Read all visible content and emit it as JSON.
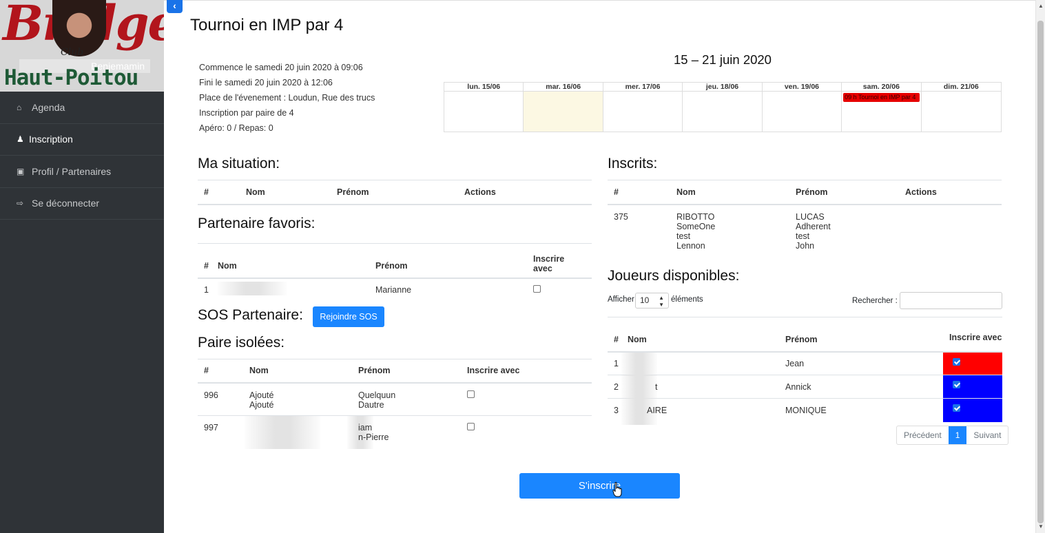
{
  "sidebar": {
    "logo_script": "Bridge",
    "logo_club": "Club",
    "username": "Benjemamin",
    "logo_region": "Haut-Poitou",
    "items": [
      {
        "label": "Agenda",
        "icon": "home-icon"
      },
      {
        "label": "Inscription",
        "icon": "users-icon"
      },
      {
        "label": "Profil / Partenaires",
        "icon": "gift-icon"
      },
      {
        "label": "Se déconnecter",
        "icon": "logout-icon"
      }
    ]
  },
  "page": {
    "title": "Tournoi en IMP par 4"
  },
  "event_info": {
    "start": "Commence le samedi 20 juin 2020 à 09:06",
    "end": "Fini le samedi 20 juin 2020 à 12:06",
    "place": "Place de l'évenement : Loudun, Rue des trucs",
    "pairs": "Inscription par paire de 4",
    "apero": "Apéro: 0 / Repas: 0"
  },
  "calendar": {
    "title": "15 – 21 juin 2020",
    "days": [
      "lun. 15/06",
      "mar. 16/06",
      "mer. 17/06",
      "jeu. 18/06",
      "ven. 19/06",
      "sam. 20/06",
      "dim. 21/06"
    ],
    "event_label": "09 h Tournoi en IMP par 4",
    "event_color": "#e60000",
    "today_color": "#fcf8e3"
  },
  "ma_situation": {
    "title": "Ma situation:",
    "columns": [
      "#",
      "Nom",
      "Prénom",
      "Actions"
    ]
  },
  "partenaire_favoris": {
    "title": "Partenaire favoris:",
    "columns": [
      "#",
      "Nom",
      "Prénom",
      "Inscrire avec"
    ],
    "rows": [
      {
        "num": "1",
        "nom": "",
        "prenom": "Marianne"
      }
    ]
  },
  "sos": {
    "title": "SOS Partenaire:",
    "button": "Rejoindre SOS"
  },
  "paire_isolees": {
    "title": "Paire isolées:",
    "columns": [
      "#",
      "Nom",
      "Prénom",
      "Inscrire avec"
    ],
    "rows": [
      {
        "num": "996",
        "nom1": "Ajouté",
        "nom2": "Ajouté",
        "prenom1": "Quelquun",
        "prenom2": "Dautre"
      },
      {
        "num": "997",
        "nom1": "",
        "nom2": "",
        "prenom1": "iam",
        "prenom2": "n-Pierre"
      }
    ]
  },
  "inscrits": {
    "title": "Inscrits:",
    "columns": [
      "#",
      "Nom",
      "Prénom",
      "Actions"
    ],
    "row": {
      "num": "375",
      "noms": [
        "RIBOTTO",
        "SomeOne",
        "test",
        "Lennon"
      ],
      "prenoms": [
        "LUCAS",
        "Adherent",
        "test",
        "John"
      ]
    }
  },
  "joueurs": {
    "title": "Joueurs disponibles:",
    "show_label": "Afficher",
    "show_value": "10",
    "show_suffix": "éléments",
    "search_label": "Rechercher :",
    "columns": [
      "#",
      "Nom",
      "Prénom",
      "Inscrire avec"
    ],
    "rows": [
      {
        "num": "1",
        "nom": "",
        "prenom": "Jean",
        "color": "#ff0000"
      },
      {
        "num": "2",
        "nom": "t",
        "prenom": "Annick",
        "color": "#0000ff"
      },
      {
        "num": "3",
        "nom": "AIRE",
        "prenom": "MONIQUE",
        "color": "#0000ff"
      }
    ],
    "pager": {
      "prev": "Précédent",
      "page": "1",
      "next": "Suivant"
    }
  },
  "submit_button": "S'inscrire",
  "accent_color": "#1a86ff"
}
